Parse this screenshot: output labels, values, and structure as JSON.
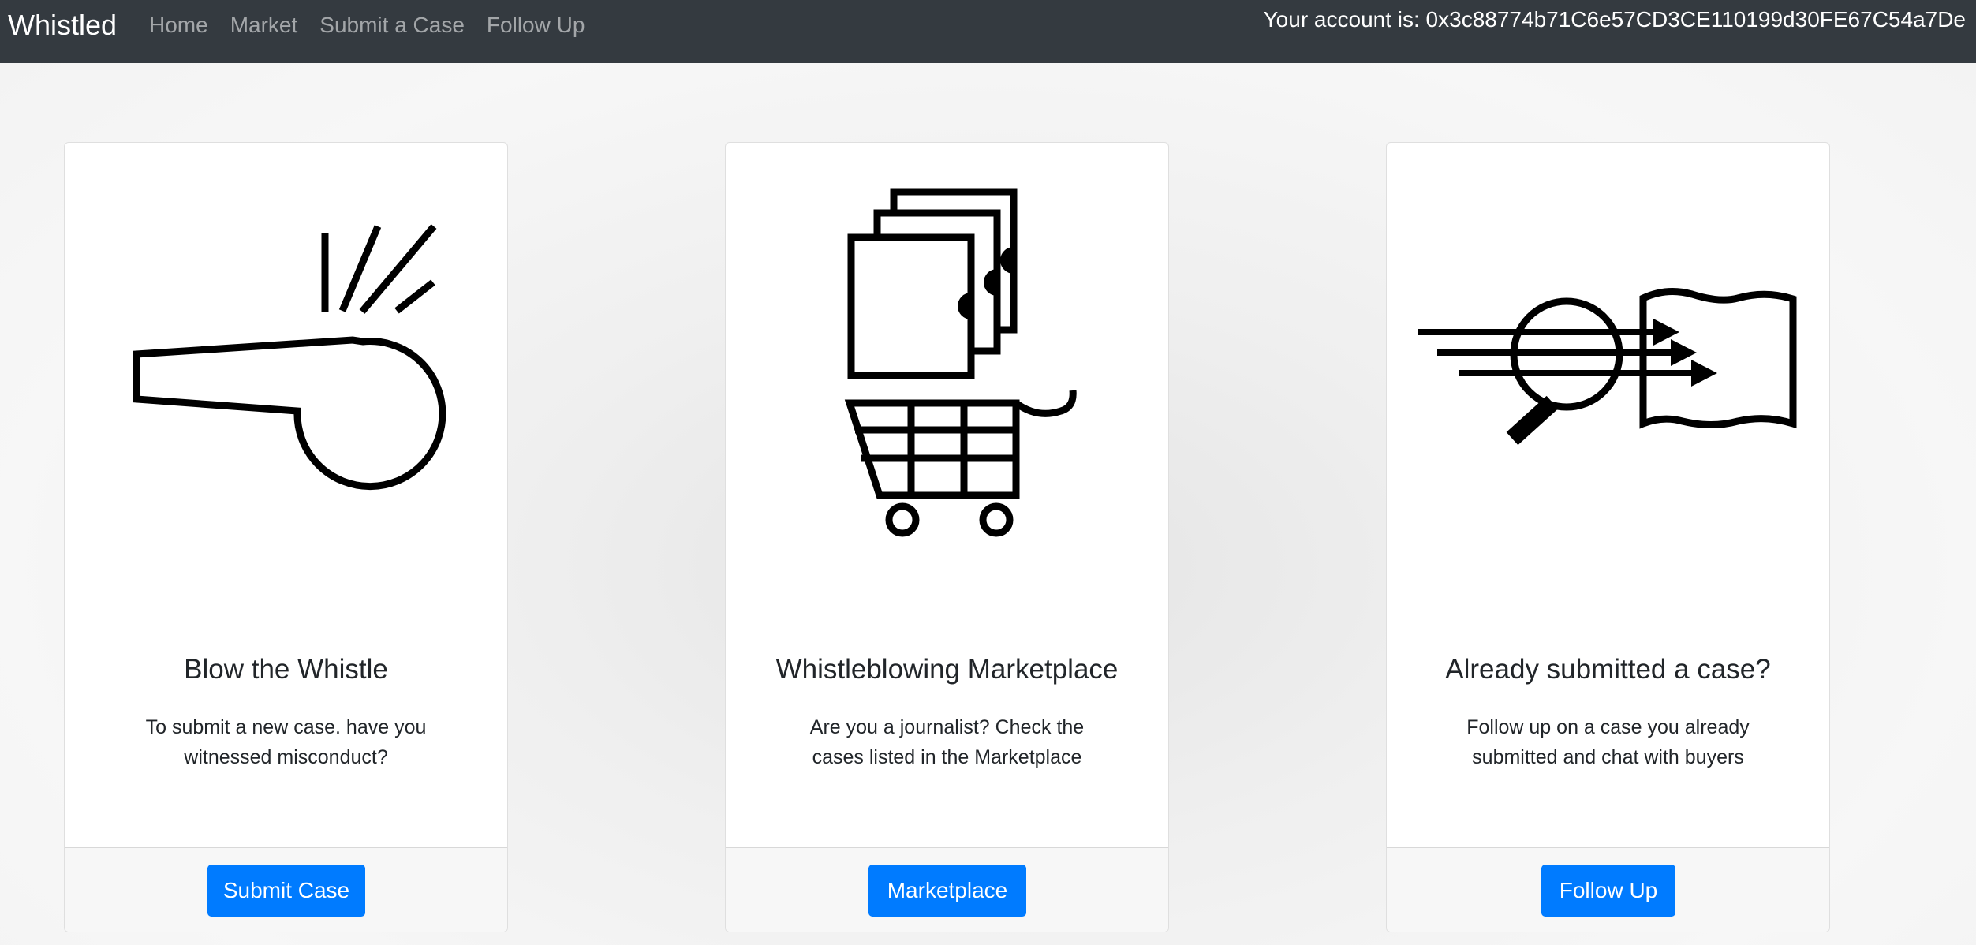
{
  "navbar": {
    "brand": "Whistled",
    "links": [
      "Home",
      "Market",
      "Submit a Case",
      "Follow Up"
    ],
    "account": "Your account is: 0x3c88774b71C6e57CD3CE110199d30FE67C54a7De"
  },
  "cards": [
    {
      "icon": "whistle-icon",
      "title": "Blow the Whistle",
      "text": "To submit a new case. have you witnessed misconduct?",
      "button": "Submit Case"
    },
    {
      "icon": "documents-cart-icon",
      "title": "Whistleblowing Marketplace",
      "text": "Are you a journalist? Check the cases listed in the Marketplace",
      "button": "Marketplace"
    },
    {
      "icon": "magnifier-document-icon",
      "title": "Already submitted a case?",
      "text": "Follow up on a case you already submitted and chat with buyers",
      "button": "Follow Up"
    }
  ],
  "colors": {
    "navbar_bg": "#343a40",
    "primary": "#007bff",
    "footer_bg": "#f7f7f7"
  }
}
